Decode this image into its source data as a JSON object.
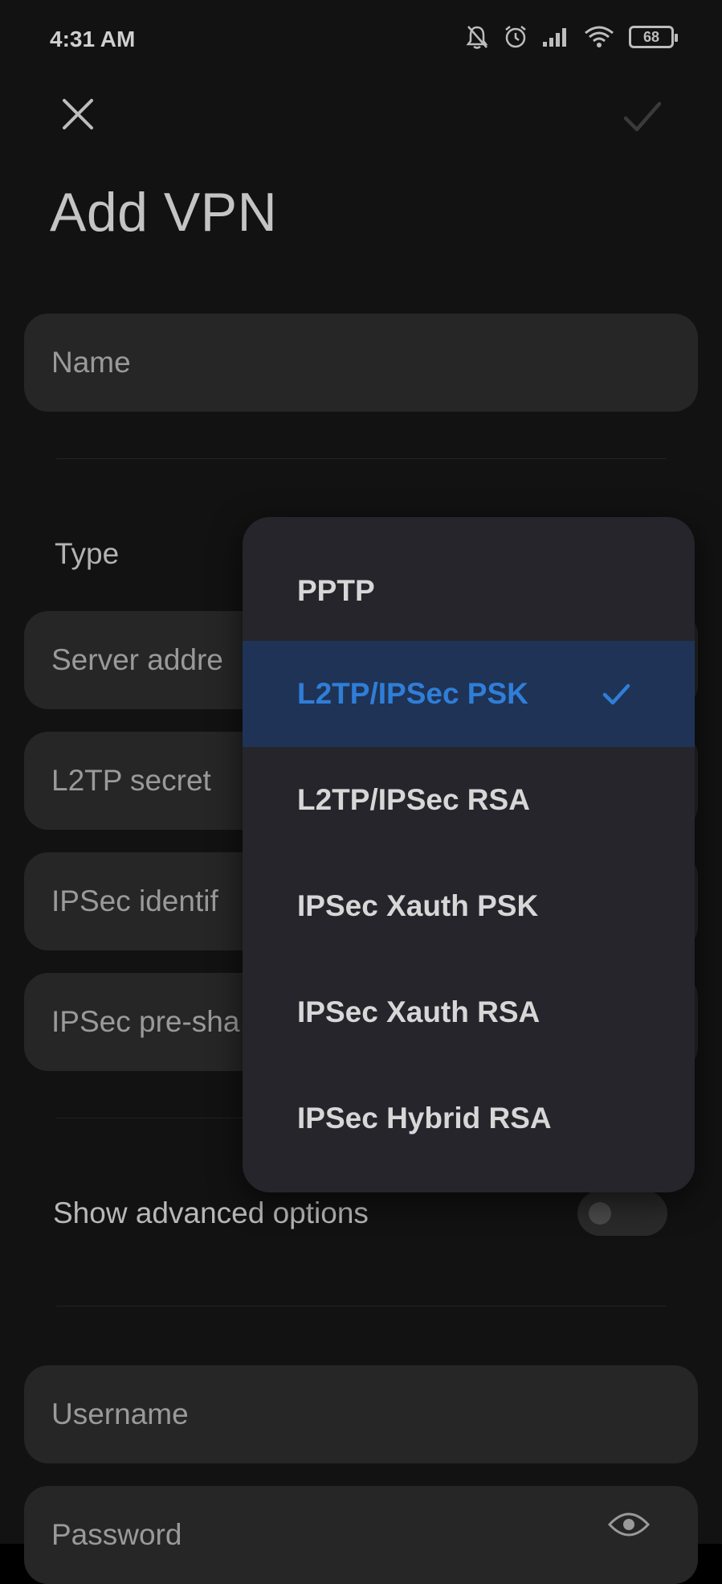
{
  "status_bar": {
    "time": "4:31 AM",
    "battery": "68",
    "icons": [
      "bell-off-icon",
      "alarm-icon",
      "signal-icon",
      "wifi-icon",
      "battery-icon"
    ]
  },
  "header": {
    "title": "Add VPN",
    "close_icon": "close-icon",
    "confirm_icon": "check-icon"
  },
  "form": {
    "name_placeholder": "Name",
    "type_label": "Type",
    "server_placeholder": "Server addre",
    "l2tp_placeholder": "L2TP secret",
    "ipsec_id_placeholder": "IPSec identif",
    "ipsec_psk_placeholder": "IPSec pre-sha",
    "advanced_label": "Show advanced options",
    "advanced_enabled": false,
    "username_placeholder": "Username",
    "password_placeholder": "Password"
  },
  "dropdown": {
    "selected": "L2TP/IPSec PSK",
    "options": [
      {
        "label": "PPTP",
        "selected": false
      },
      {
        "label": "L2TP/IPSec PSK",
        "selected": true
      },
      {
        "label": "L2TP/IPSec RSA",
        "selected": false
      },
      {
        "label": "IPSec Xauth PSK",
        "selected": false
      },
      {
        "label": "IPSec Xauth RSA",
        "selected": false
      },
      {
        "label": "IPSec Hybrid RSA",
        "selected": false
      }
    ]
  },
  "colors": {
    "background": "#121212",
    "field": "#262626",
    "dropdown": "#25252b",
    "selected_bg": "#1f3356",
    "accent": "#2f7ed8"
  }
}
